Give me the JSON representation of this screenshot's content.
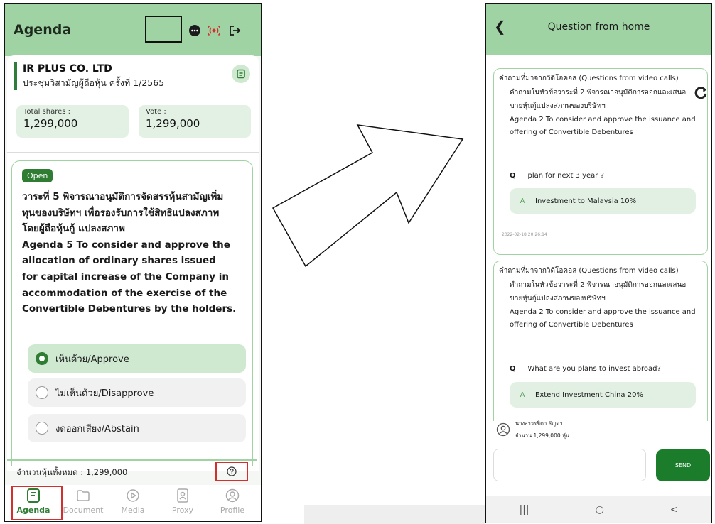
{
  "left": {
    "header_title": "Agenda",
    "company_name": "IR PLUS CO. LTD",
    "meeting_name": "ประชุมวิสามัญผู้ถือหุ้น ครั้งที่ 1/2565",
    "total_shares_label": "Total shares :",
    "total_shares_value": "1,299,000",
    "vote_label": "Vote :",
    "vote_value": "1,299,000",
    "status_badge": "Open",
    "agenda_lines": [
      "วาระที่ 5 พิจารณาอนุมัติการจัดสรรหุ้นสามัญเพิ่ม",
      "ทุนของบริษัทฯ เพื่อรองรับการใช้สิทธิแปลงสภาพ",
      "โดยผู้ถือหุ้นกู้ แปลงสภาพ",
      "Agenda 5 To consider and approve the",
      "allocation of ordinary shares issued",
      "for capital increase of the Company in",
      "accommodation of the exercise of the",
      "Convertible Debentures by the holders."
    ],
    "options": [
      {
        "label": "เห็นด้วย/Approve",
        "selected": true
      },
      {
        "label": "ไม่เห็นด้วย/Disapprove",
        "selected": false
      },
      {
        "label": "งดออกเสียง/Abstain",
        "selected": false
      }
    ],
    "total_text": "จำนวนหุ้นทั้งหมด : 1,299,000",
    "nav": [
      {
        "label": "Agenda",
        "icon": "agenda-icon",
        "active": true
      },
      {
        "label": "Document",
        "icon": "folder-icon",
        "active": false
      },
      {
        "label": "Media",
        "icon": "play-icon",
        "active": false
      },
      {
        "label": "Proxy",
        "icon": "proxy-doc-icon",
        "active": false
      },
      {
        "label": "Profile",
        "icon": "profile-icon",
        "active": false
      }
    ],
    "colors": {
      "header": "#9fd3a3",
      "accent": "#2e7d32",
      "highlight_box": "#d32f2f"
    }
  },
  "right": {
    "header_title": "Question from home",
    "questions": [
      {
        "source": "คำถามที่มาจากวิดีโอคอล (Questions from video calls)",
        "agenda_th_1": "คำถามในหัวข้อวาระที่ 2 พิจารณาอนุมัติการออกและเสนอ",
        "agenda_th_2": "ขายหุ้นกู้แปลงสภาพของบริษัทฯ",
        "agenda_en_1": "Agenda 2 To consider and approve the issuance and",
        "agenda_en_2": "offering of Convertible Debentures",
        "q_marker": "Q",
        "question": "plan for next 3 year ?",
        "a_marker": "A",
        "answer": "Investment to Malaysia 10%",
        "timestamp": "2022-02-18 20:26:14"
      },
      {
        "source": "คำถามที่มาจากวิดีโอคอล (Questions from video calls)",
        "agenda_th_1": "คำถามในหัวข้อวาระที่ 2 พิจารณาอนุมัติการออกและเสนอ",
        "agenda_th_2": "ขายหุ้นกู้แปลงสภาพของบริษัทฯ",
        "agenda_en_1": "Agenda 2 To consider and approve the issuance and",
        "agenda_en_2": "offering of Convertible Debentures",
        "q_marker": "Q",
        "question": "What are you plans to invest abroad?",
        "a_marker": "A",
        "answer": "Extend Investment China 20%"
      }
    ],
    "user_name": "นางสาวรชิดา ธัญดา",
    "user_shares": "จำนวน 1,299,000 หุ้น",
    "send_label": "SEND",
    "system_nav": [
      "|||",
      "○",
      "<"
    ]
  }
}
